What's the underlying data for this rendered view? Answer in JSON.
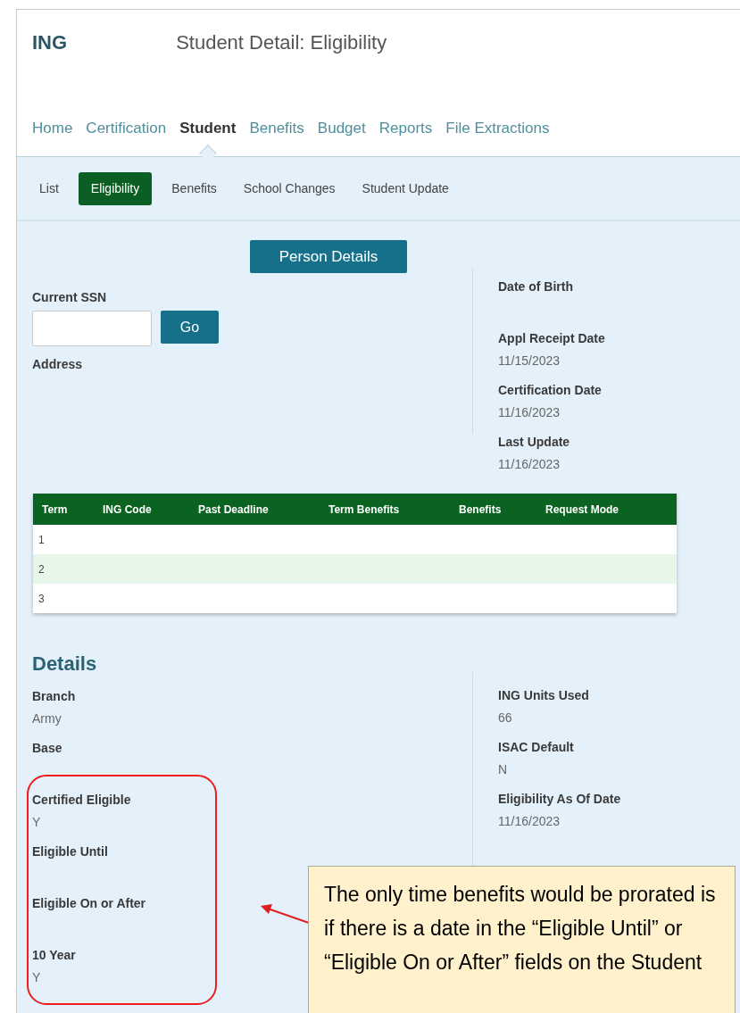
{
  "app_title": "ING",
  "page_title": "Student Detail: Eligibility",
  "main_nav": [
    {
      "label": "Home",
      "selected": false
    },
    {
      "label": "Certification",
      "selected": false
    },
    {
      "label": "Student",
      "selected": true
    },
    {
      "label": "Benefits",
      "selected": false
    },
    {
      "label": "Budget",
      "selected": false
    },
    {
      "label": "Reports",
      "selected": false
    },
    {
      "label": "File Extractions",
      "selected": false
    }
  ],
  "sub_nav": [
    {
      "label": "List",
      "selected": false
    },
    {
      "label": "Eligibility",
      "selected": true
    },
    {
      "label": "Benefits",
      "selected": false
    },
    {
      "label": "School Changes",
      "selected": false
    },
    {
      "label": "Student Update",
      "selected": false
    }
  ],
  "person_details_button": "Person Details",
  "ssn": {
    "label": "Current SSN",
    "go_button": "Go"
  },
  "address_label": "Address",
  "person_fields": [
    {
      "label": "Date of Birth"
    },
    {
      "label": "Appl Receipt Date",
      "value": "11/15/2023"
    },
    {
      "label": "Certification Date",
      "value": "11/16/2023"
    },
    {
      "label": "Last Update",
      "value": "11/16/2023"
    }
  ],
  "table": {
    "columns": [
      "Term",
      "ING Code",
      "Past Deadline",
      "Term Benefits",
      "Benefits",
      "Request Mode"
    ],
    "rows": [
      {
        "term": "1"
      },
      {
        "term": "2"
      },
      {
        "term": "3"
      }
    ]
  },
  "details": {
    "title": "Details",
    "left_fields": [
      {
        "label": "Branch",
        "value": "Army"
      },
      {
        "label": "Base"
      },
      {
        "label": "Certified Eligible",
        "value": "Y"
      },
      {
        "label": "Eligible Until"
      },
      {
        "label": "Eligible On or After"
      },
      {
        "label": "10 Year",
        "value": "Y"
      }
    ],
    "right_fields": [
      {
        "label": "ING Units Used",
        "value": "66"
      },
      {
        "label": "ISAC Default",
        "value": "N"
      },
      {
        "label": "Eligibility As Of Date",
        "value": "11/16/2023"
      }
    ]
  },
  "callout": {
    "text": "The only time benefits would be prorated is if there is a date in the “Eligible Until” or “Eligible On or After” fields on the Student"
  }
}
